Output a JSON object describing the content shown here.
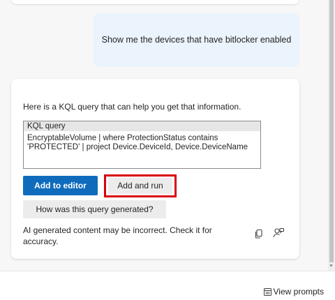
{
  "user_message": "Show me the devices that have bitlocker enabled",
  "response": {
    "intro": "Here is a KQL query that can help you get that information.",
    "query_label": "KQL query",
    "query_lines": [
      "EncryptableVolume | where ProtectionStatus contains",
      "'PROTECTED' | project Device.DeviceId, Device.DeviceName"
    ],
    "add_to_editor_label": "Add to editor",
    "add_and_run_label": "Add and run",
    "how_generated_label": "How was this query generated?",
    "disclaimer": "AI generated content may be incorrect. Check it for accuracy.",
    "copy_icon": "copy-icon",
    "feedback_icon": "feedback-icon"
  },
  "footer": {
    "view_prompts_label": "View prompts",
    "view_prompts_icon": "prompts-icon"
  },
  "colors": {
    "primary": "#0f6cbd",
    "highlight": "#d9000d",
    "user_bubble": "#ebf3fc"
  }
}
